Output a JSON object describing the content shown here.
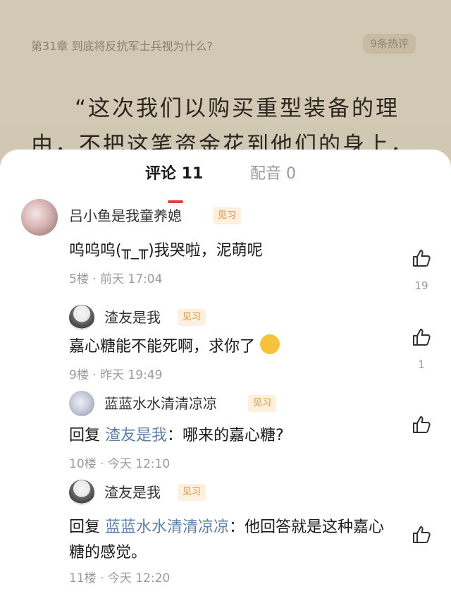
{
  "reader": {
    "chapter_title": "第31章 到底将反抗军士兵视为什么?",
    "hot_badge": "9条热评",
    "passage": "“这次我们以购买重型装备的理由，不把这笔资金花到他们的身上，那"
  },
  "tabs": [
    {
      "label": "评论 11",
      "active": true
    },
    {
      "label": "配音 0",
      "active": false
    }
  ],
  "comments": [
    {
      "user": "吕小鱼是我童养媳",
      "level": "见习",
      "content": "呜呜呜(╥_╥)我哭啦，泥萌呢",
      "floor": "5楼 · 前天 17:04",
      "likes": "19",
      "avatar": "avatar-icon"
    },
    {
      "user": "渣友是我",
      "level": "见习",
      "content": "嘉心糖能不能死啊，求你了",
      "emoji": "sweat-smile-emoji",
      "floor": "9楼 · 昨天 19:49",
      "likes": "1",
      "avatar": "avatar-icon"
    },
    {
      "user": "蓝蓝水水清清凉凉",
      "level": "见习",
      "reply_prefix": "回复",
      "reply_to": "渣友是我",
      "content": "：哪来的嘉心糖?",
      "floor": "10楼 · 今天 12:10",
      "likes": "",
      "avatar": "avatar-icon"
    },
    {
      "user": "渣友是我",
      "level": "见习",
      "reply_prefix": "回复",
      "reply_to": "蓝蓝水水清清凉凉",
      "content": "：他回答就是这种嘉心糖的感觉。",
      "floor": "11楼 · 今天 12:20",
      "likes": "",
      "avatar": "avatar-icon"
    }
  ],
  "colors": {
    "accent": "#e0413a",
    "mention": "#5b7fa9",
    "level_tag": "#e58a2c"
  }
}
